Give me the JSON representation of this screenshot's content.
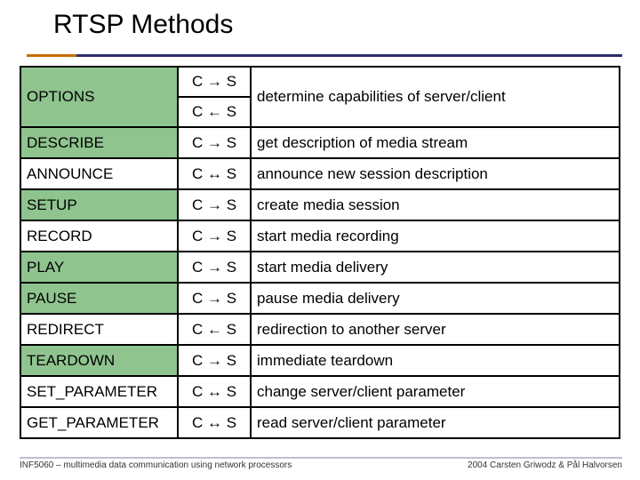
{
  "title": "RTSP Methods",
  "rows": [
    {
      "method": "OPTIONS",
      "green": true,
      "dir": [
        "C → S",
        "C ← S"
      ],
      "desc": "determine capabilities of server/client"
    },
    {
      "method": "DESCRIBE",
      "green": true,
      "dir": [
        "C → S"
      ],
      "desc": "get description of media stream"
    },
    {
      "method": "ANNOUNCE",
      "green": false,
      "dir": [
        "C ↔ S"
      ],
      "desc": "announce new session description"
    },
    {
      "method": "SETUP",
      "green": true,
      "dir": [
        "C → S"
      ],
      "desc": "create media session"
    },
    {
      "method": "RECORD",
      "green": false,
      "dir": [
        "C → S"
      ],
      "desc": "start media recording"
    },
    {
      "method": "PLAY",
      "green": true,
      "dir": [
        "C → S"
      ],
      "desc": "start media delivery"
    },
    {
      "method": "PAUSE",
      "green": true,
      "dir": [
        "C → S"
      ],
      "desc": "pause media delivery"
    },
    {
      "method": "REDIRECT",
      "green": false,
      "dir": [
        "C ← S"
      ],
      "desc": "redirection to another server"
    },
    {
      "method": "TEARDOWN",
      "green": true,
      "dir": [
        "C → S"
      ],
      "desc": "immediate teardown"
    },
    {
      "method": "SET_PARAMETER",
      "green": false,
      "dir": [
        "C ↔ S"
      ],
      "desc": "change server/client parameter"
    },
    {
      "method": "GET_PARAMETER",
      "green": false,
      "dir": [
        "C ↔ S"
      ],
      "desc": "read server/client parameter"
    }
  ],
  "footer": {
    "left": "INF5060 – multimedia data communication using network processors",
    "right": "2004 Carsten Griwodz & Pål Halvorsen"
  },
  "chart_data": {
    "type": "table",
    "title": "RTSP Methods",
    "columns": [
      "Method",
      "Direction",
      "Description"
    ],
    "rows": [
      [
        "OPTIONS",
        "C → S / C ← S",
        "determine capabilities of server/client"
      ],
      [
        "DESCRIBE",
        "C → S",
        "get description of media stream"
      ],
      [
        "ANNOUNCE",
        "C ↔ S",
        "announce new session description"
      ],
      [
        "SETUP",
        "C → S",
        "create media session"
      ],
      [
        "RECORD",
        "C → S",
        "start media recording"
      ],
      [
        "PLAY",
        "C → S",
        "start media delivery"
      ],
      [
        "PAUSE",
        "C → S",
        "pause media delivery"
      ],
      [
        "REDIRECT",
        "C ← S",
        "redirection to another server"
      ],
      [
        "TEARDOWN",
        "C → S",
        "immediate teardown"
      ],
      [
        "SET_PARAMETER",
        "C ↔ S",
        "change server/client parameter"
      ],
      [
        "GET_PARAMETER",
        "C ↔ S",
        "read server/client parameter"
      ]
    ]
  }
}
